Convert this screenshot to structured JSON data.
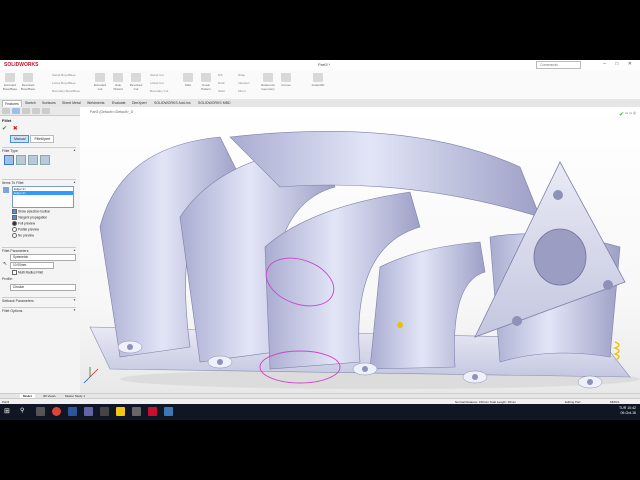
{
  "app": {
    "logo": "SOLIDWORKS",
    "doc_title": "Part3 *",
    "search_placeholder": "Commands",
    "window_controls": "– □ ✕"
  },
  "ribbon": {
    "buttons": [
      "Extruded Boss/Base",
      "Revolved Boss/Base",
      "Extruded Cut",
      "Hole Wizard",
      "Revolved Cut",
      "Fillet",
      "Linear Pattern",
      "Rib",
      "Draft",
      "Reference Geometry",
      "Curves",
      "Instant3D"
    ],
    "small_items": [
      "Swept Boss/Base",
      "Lofted Boss/Base",
      "Boundary Boss/Base",
      "Swept Cut",
      "Lofted Cut",
      "Boundary Cut",
      "Wrap",
      "Intersect",
      "Mirror",
      "Shell"
    ]
  },
  "command_tabs": [
    "Features",
    "Sketch",
    "Surfaces",
    "Sheet Metal",
    "Weldments",
    "Evaluate",
    "DimXpert",
    "SOLIDWORKS Add-Ins",
    "SOLIDWORKS MBD"
  ],
  "active_command_tab": "Features",
  "property_manager": {
    "title": "Fillet",
    "ok": "✔",
    "cancel": "✖",
    "mode_tabs": [
      "Manual",
      "FilletXpert"
    ],
    "active_mode": "Manual",
    "fillet_type_label": "Fillet Type",
    "items_label": "Items To Fillet",
    "items": [
      "Edge<1>",
      "Edge<2>"
    ],
    "selected_item": "Edge<2>",
    "options": [
      {
        "label": "Show selection toolbar",
        "checked": true
      },
      {
        "label": "Tangent propagation",
        "checked": true
      }
    ],
    "preview": [
      {
        "label": "Full preview",
        "selected": true
      },
      {
        "label": "Partial preview",
        "selected": false
      },
      {
        "label": "No preview",
        "selected": false
      }
    ],
    "parameters_label": "Fillet Parameters",
    "method": "Symmetric",
    "radius": "10.00mm",
    "multi_radius": {
      "label": "Multi Radius Fillet",
      "checked": false
    },
    "profile_label": "Profile:",
    "profile": "Circular",
    "setback_label": "Setback Parameters",
    "fillet_options_label": "Fillet Options"
  },
  "viewport": {
    "breadcrumb": "Part3 (Default<<Default>_D",
    "tree_hint": "Triad"
  },
  "bottom_tabs": [
    "Model",
    "3D Views",
    "Motion Study 1"
  ],
  "active_bottom_tab": "Model",
  "status": {
    "left": "Part3",
    "measure": "Normal Distance: 150mm Total Length: 28mm",
    "editing": "Editing Part",
    "units": "MMGS"
  },
  "taskbar": {
    "time": "10:42",
    "date": "09-Oct-16",
    "lang": "TUR"
  },
  "colors": {
    "model": "#c9cce6",
    "selection": "#cc44cc",
    "accent": "#3399ff",
    "taskbar": "#101623"
  }
}
